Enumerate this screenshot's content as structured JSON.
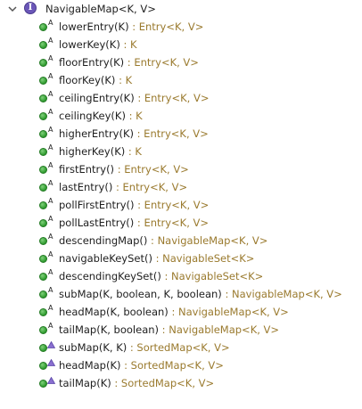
{
  "root": {
    "label": "NavigableMap<K, V>",
    "icon": "interface-icon",
    "icon_letter": "I",
    "expanded": true
  },
  "methods": [
    {
      "sig": "lowerEntry(K)",
      "ret": " : Entry<K, V>",
      "kind": "abstract"
    },
    {
      "sig": "lowerKey(K)",
      "ret": " : K",
      "kind": "abstract"
    },
    {
      "sig": "floorEntry(K)",
      "ret": " : Entry<K, V>",
      "kind": "abstract"
    },
    {
      "sig": "floorKey(K)",
      "ret": " : K",
      "kind": "abstract"
    },
    {
      "sig": "ceilingEntry(K)",
      "ret": " : Entry<K, V>",
      "kind": "abstract"
    },
    {
      "sig": "ceilingKey(K)",
      "ret": " : K",
      "kind": "abstract"
    },
    {
      "sig": "higherEntry(K)",
      "ret": " : Entry<K, V>",
      "kind": "abstract"
    },
    {
      "sig": "higherKey(K)",
      "ret": " : K",
      "kind": "abstract"
    },
    {
      "sig": "firstEntry()",
      "ret": " : Entry<K, V>",
      "kind": "abstract"
    },
    {
      "sig": "lastEntry()",
      "ret": " : Entry<K, V>",
      "kind": "abstract"
    },
    {
      "sig": "pollFirstEntry()",
      "ret": " : Entry<K, V>",
      "kind": "abstract"
    },
    {
      "sig": "pollLastEntry()",
      "ret": " : Entry<K, V>",
      "kind": "abstract"
    },
    {
      "sig": "descendingMap()",
      "ret": " : NavigableMap<K, V>",
      "kind": "abstract"
    },
    {
      "sig": "navigableKeySet()",
      "ret": " : NavigableSet<K>",
      "kind": "abstract"
    },
    {
      "sig": "descendingKeySet()",
      "ret": " : NavigableSet<K>",
      "kind": "abstract"
    },
    {
      "sig": "subMap(K, boolean, K, boolean)",
      "ret": " : NavigableMap<K, V>",
      "kind": "abstract"
    },
    {
      "sig": "headMap(K, boolean)",
      "ret": " : NavigableMap<K, V>",
      "kind": "abstract"
    },
    {
      "sig": "tailMap(K, boolean)",
      "ret": " : NavigableMap<K, V>",
      "kind": "abstract"
    },
    {
      "sig": "subMap(K, K)",
      "ret": " : SortedMap<K, V>",
      "kind": "default"
    },
    {
      "sig": "headMap(K)",
      "ret": " : SortedMap<K, V>",
      "kind": "default"
    },
    {
      "sig": "tailMap(K)",
      "ret": " : SortedMap<K, V>",
      "kind": "default"
    }
  ],
  "colors": {
    "return_type": "#9a7a2e",
    "method_icon": "#2e9a2e",
    "interface_icon": "#6b57b8"
  }
}
